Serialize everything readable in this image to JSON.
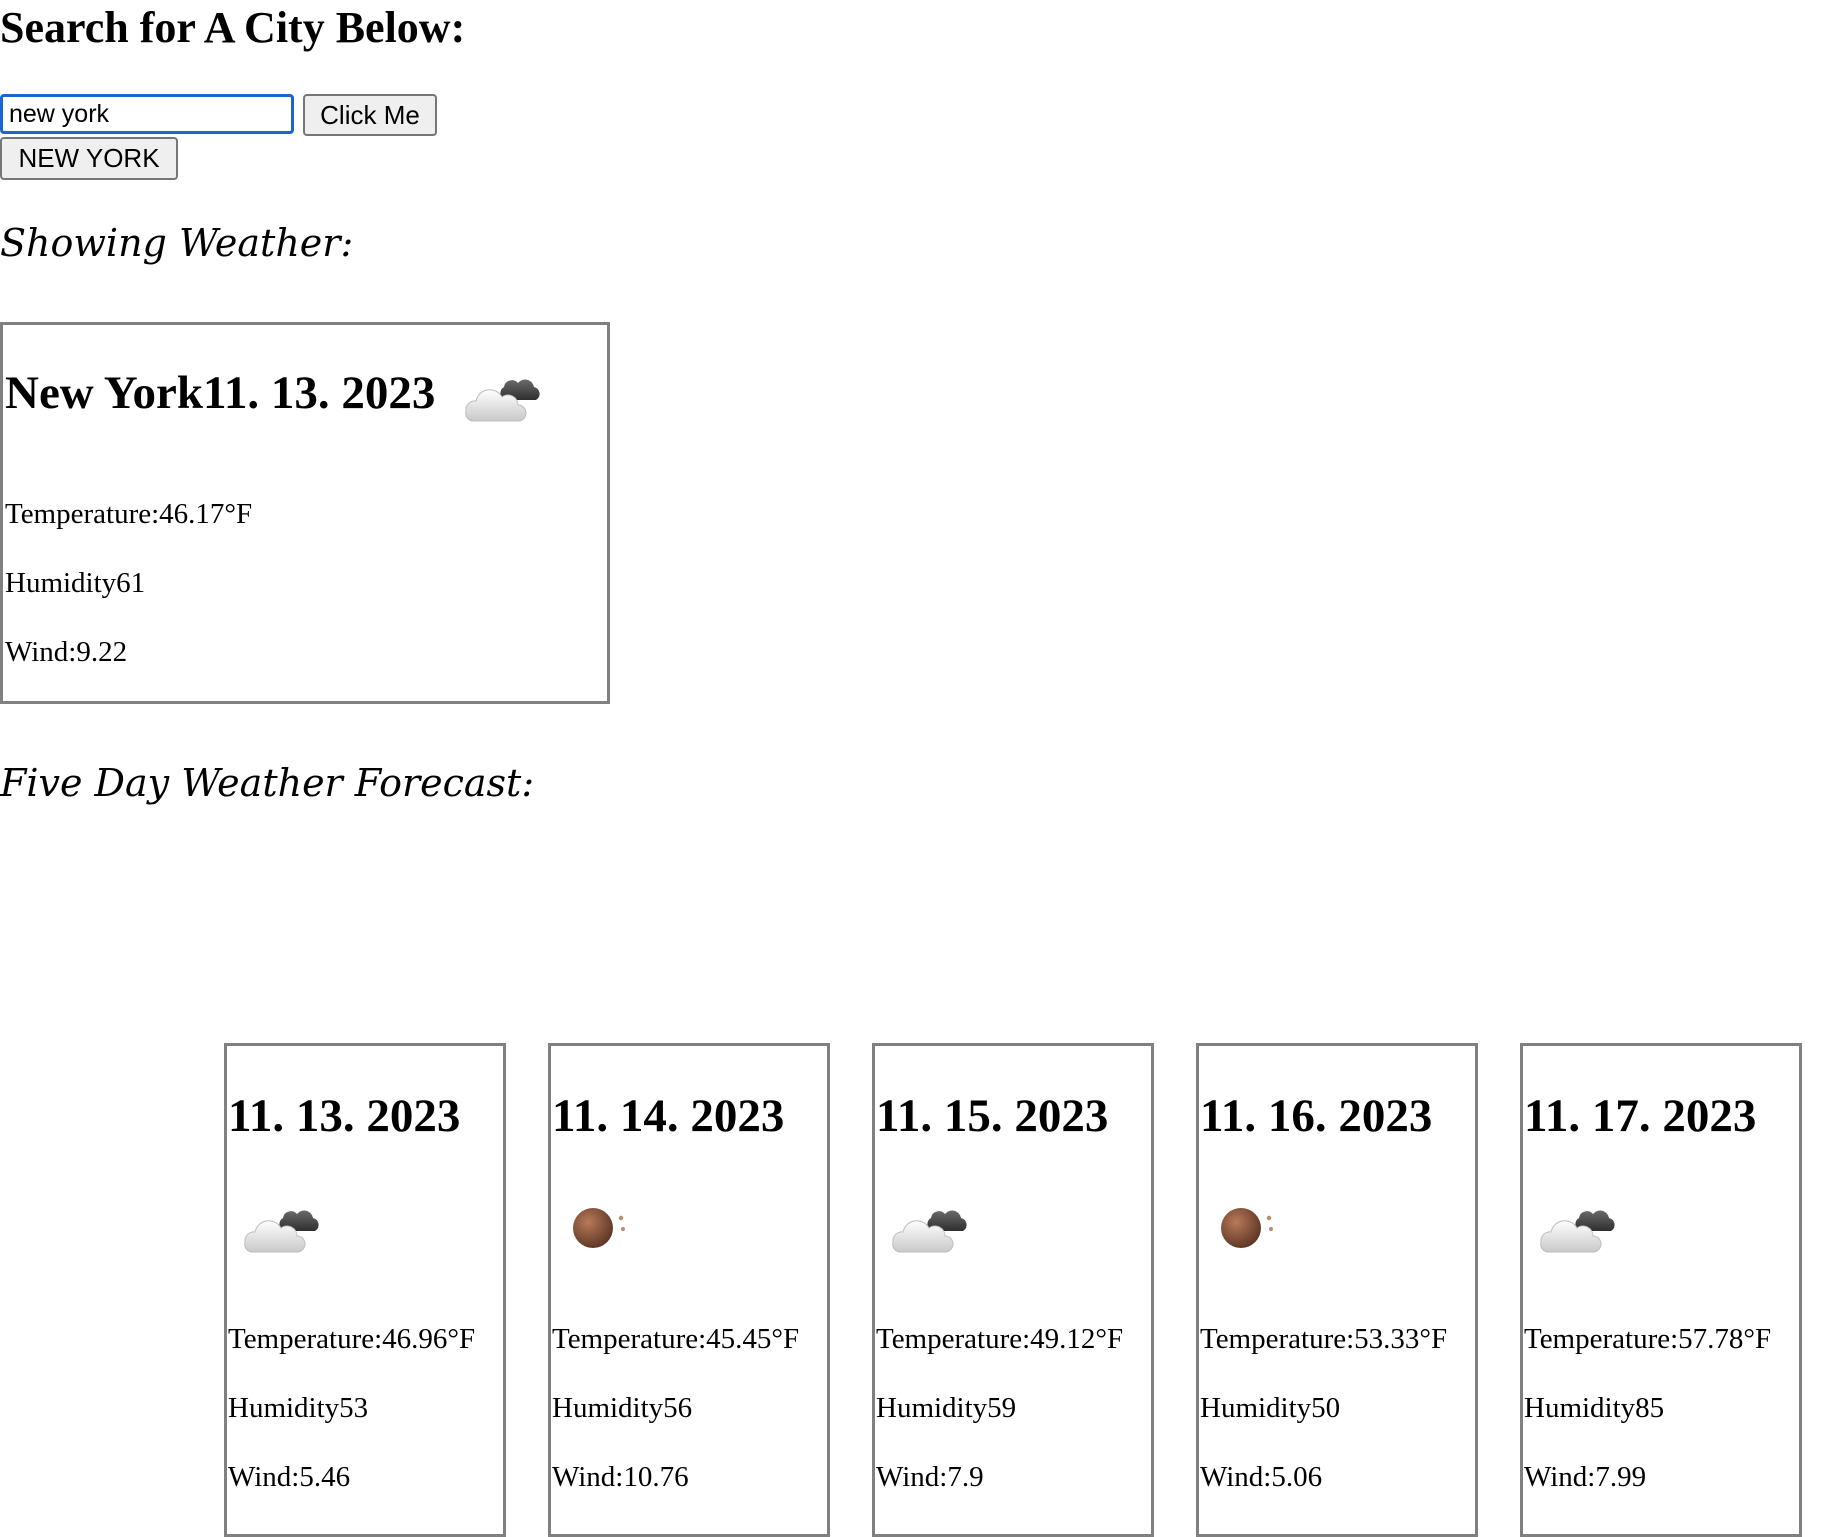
{
  "search": {
    "title": "Search for A City Below:",
    "input_value": "new york",
    "button_label": "Click Me",
    "history": [
      "NEW YORK"
    ]
  },
  "current": {
    "heading": "Showing Weather:",
    "title": "New York11. 13. 2023",
    "icon": "cloudy-icon",
    "temperature": "Temperature:46.17°F",
    "humidity": "Humidity61",
    "wind": "Wind:9.22"
  },
  "forecast": {
    "heading": "Five Day Weather Forecast:",
    "days": [
      {
        "date": "11. 13. 2023",
        "icon": "cloudy-icon",
        "temperature": "Temperature:46.96°F",
        "humidity": "Humidity53",
        "wind": "Wind:5.46"
      },
      {
        "date": "11. 14. 2023",
        "icon": "moon-icon",
        "temperature": "Temperature:45.45°F",
        "humidity": "Humidity56",
        "wind": "Wind:10.76"
      },
      {
        "date": "11. 15. 2023",
        "icon": "cloudy-icon",
        "temperature": "Temperature:49.12°F",
        "humidity": "Humidity59",
        "wind": "Wind:7.9"
      },
      {
        "date": "11. 16. 2023",
        "icon": "moon-icon",
        "temperature": "Temperature:53.33°F",
        "humidity": "Humidity50",
        "wind": "Wind:5.06"
      },
      {
        "date": "11. 17. 2023",
        "icon": "cloudy-icon",
        "temperature": "Temperature:57.78°F",
        "humidity": "Humidity85",
        "wind": "Wind:7.99"
      }
    ]
  },
  "colors": {
    "focus_border": "#1a66d1",
    "card_border": "#808080",
    "button_bg": "#efefef"
  }
}
